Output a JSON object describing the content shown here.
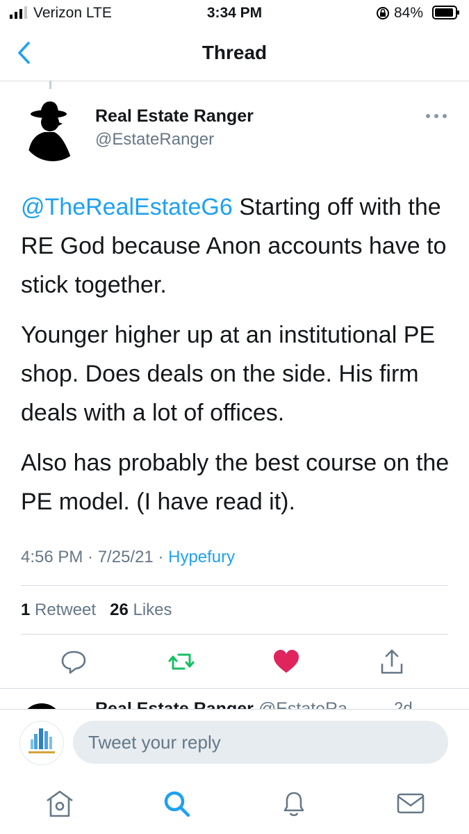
{
  "status_bar": {
    "carrier": "Verizon  LTE",
    "time": "3:34 PM",
    "battery": "84%"
  },
  "nav": {
    "title": "Thread",
    "back_icon": "chevron-left-icon"
  },
  "tweet": {
    "name": "Real Estate Ranger",
    "handle": "@EstateRanger",
    "mention": "@TheRealEstateG6",
    "p1_rest": " Starting off with the RE God because Anon accounts have to stick together.",
    "p2": "Younger higher up at an institutional PE shop. Does deals on the side. His firm deals with a  lot of offices.",
    "p3": "Also has probably the best course on the PE model. (I have read it).",
    "time": "4:56 PM · 7/25/21 · ",
    "source": "Hypefury",
    "retweets": "1",
    "retweets_label": "Retweet",
    "likes": "26",
    "likes_label": "Likes"
  },
  "next_tweet": {
    "name": "Real Estate Ranger",
    "handle": "@EstateRa",
    "age": "2d"
  },
  "reply": {
    "placeholder": "Tweet your reply"
  },
  "colors": {
    "accent": "#1da1f2",
    "like": "#e0245e",
    "retweet": "#17bf63",
    "muted": "#657786"
  },
  "icons": [
    "reply-icon",
    "retweet-icon",
    "like-icon",
    "share-icon",
    "home-icon",
    "search-icon",
    "notifications-icon",
    "messages-icon"
  ]
}
